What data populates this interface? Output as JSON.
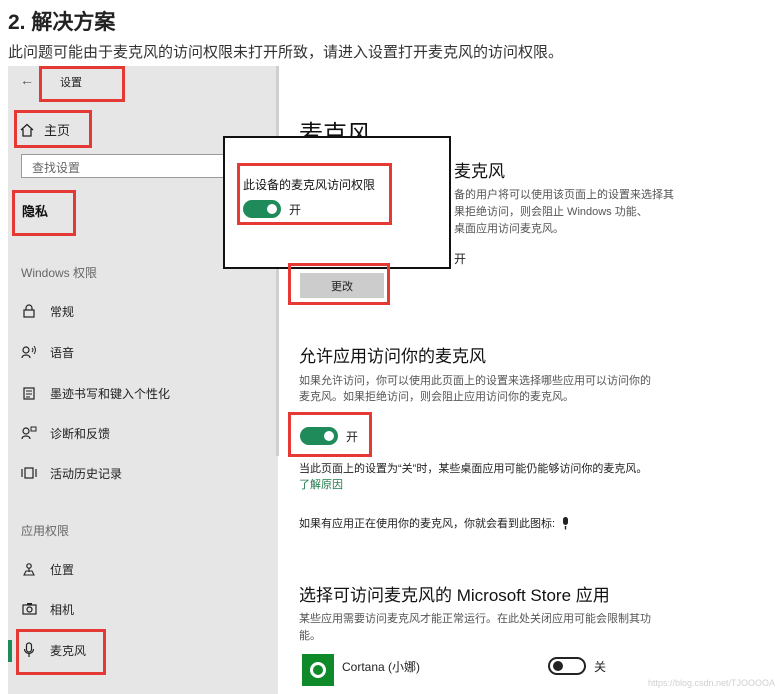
{
  "article": {
    "title": "2. 解决方案",
    "description": "此问题可能由于麦克风的访问权限未打开所致，请进入设置打开麦克风的访问权限。"
  },
  "window": {
    "title": "设置",
    "back_icon": "back-arrow-icon"
  },
  "sidebar": {
    "home": "主页",
    "search_placeholder": "查找设置",
    "privacy": "隐私",
    "windows_permissions_header": "Windows 权限",
    "windows_items": [
      "常规",
      "语音",
      "墨迹书写和键入个性化",
      "诊断和反馈",
      "活动历史记录"
    ],
    "app_permissions_header": "应用权限",
    "app_items": [
      "位置",
      "相机",
      "麦克风"
    ],
    "selected": "麦克风",
    "accent": "#1f8a5a"
  },
  "main": {
    "title": "麦克风",
    "device_heading_fragment": "麦克风",
    "device_desc_lines": [
      "备的用户将可以使用该页面上的设置来选择其",
      "果拒绝访问，则会阻止 Windows 功能、",
      "桌面应用访问麦克风。"
    ],
    "device_status_fragment": "开",
    "change_button": "更改",
    "apps_heading": "允许应用访问你的麦克风",
    "apps_desc_lines": [
      "如果允许访问，你可以使用此页面上的设置来选择哪些应用可以访问你的",
      "麦克风。如果拒绝访问，则会阻止应用访问你的麦克风。"
    ],
    "apps_toggle_label": "开",
    "note": "当此页面上的设置为“关”时，某些桌面应用可能仍能够访问你的麦克风。",
    "learn_more": "了解原因",
    "icon_note": "如果有应用正在使用你的麦克风，你就会看到此图标:",
    "store_heading": "选择可访问麦克风的 Microsoft Store 应用",
    "store_desc_lines": [
      "某些应用需要访问麦克风才能正常运行。在此处关闭应用可能会限制其功",
      "能。"
    ],
    "apps": [
      {
        "name": "Cortana (小娜)",
        "toggle_label": "关"
      }
    ]
  },
  "popup": {
    "label": "此设备的麦克风访问权限",
    "toggle_label": "开"
  },
  "watermark": "https://blog.csdn.net/TJOOOOA"
}
